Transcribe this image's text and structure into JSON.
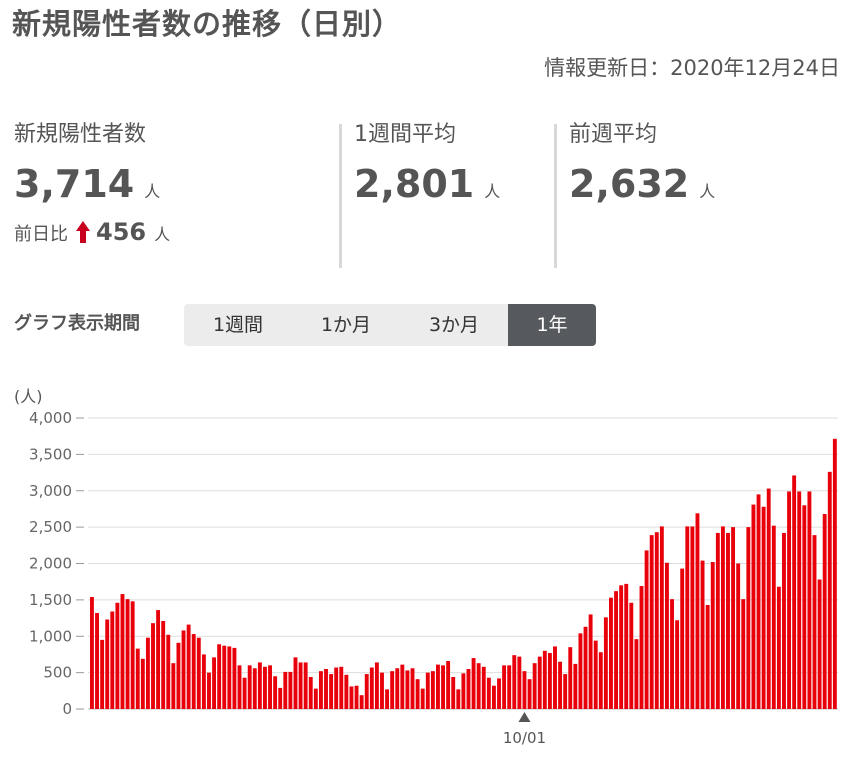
{
  "header": {
    "title": "新規陽性者数の推移（日別）",
    "updated": "情報更新日：2020年12月24日"
  },
  "stats": [
    {
      "label": "新規陽性者数",
      "value": "3,714",
      "unit": "人"
    },
    {
      "label": "1週間平均",
      "value": "2,801",
      "unit": "人"
    },
    {
      "label": "前週平均",
      "value": "2,632",
      "unit": "人"
    }
  ],
  "diff": {
    "label": "前日比",
    "value": "456",
    "unit": "人",
    "direction": "up",
    "arrow_color": "#c8001e"
  },
  "period": {
    "label": "グラフ表示期間",
    "tabs": [
      "1週間",
      "1か月",
      "3か月",
      "1年"
    ],
    "selected": "1年"
  },
  "chart_data": {
    "type": "bar",
    "ylabel": "(人)",
    "ylim": [
      0,
      4000
    ],
    "yticks": [
      "0",
      "500",
      "1,000",
      "1,500",
      "2,000",
      "2,500",
      "3,000",
      "3,500",
      "4,000"
    ],
    "xticks": [
      {
        "label": "10/01",
        "index": 85
      }
    ],
    "bar_color": "#e8000b",
    "grid": true,
    "series": [
      {
        "values": [
          1540,
          1320,
          950,
          1230,
          1340,
          1460,
          1580,
          1510,
          1480,
          830,
          690,
          980,
          1180,
          1360,
          1210,
          1020,
          630,
          910,
          1080,
          1160,
          1030,
          980,
          750,
          500,
          710,
          890,
          870,
          860,
          840,
          600,
          430,
          600,
          560,
          640,
          580,
          600,
          450,
          290,
          510,
          510,
          710,
          640,
          640,
          440,
          280,
          520,
          550,
          480,
          570,
          580,
          470,
          310,
          320,
          190,
          480,
          570,
          640,
          500,
          270,
          520,
          560,
          610,
          530,
          560,
          410,
          280,
          500,
          520,
          610,
          600,
          660,
          440,
          270,
          490,
          550,
          700,
          630,
          580,
          430,
          320,
          420,
          600,
          600,
          740,
          720,
          520,
          410,
          630,
          720,
          800,
          770,
          860,
          650,
          480,
          850,
          620,
          1040,
          1130,
          1300,
          940,
          780,
          1260,
          1530,
          1620,
          1700,
          1720,
          1460,
          960,
          1690,
          2180,
          2390,
          2430,
          2510,
          2010,
          1510,
          1220,
          1930,
          2510,
          2510,
          2690,
          2040,
          1430,
          2020,
          2420,
          2510,
          2420,
          2500,
          2000,
          1510,
          2500,
          2810,
          2950,
          2780,
          3030,
          2520,
          1680,
          2420,
          2990,
          3210,
          2990,
          2800,
          2990,
          2390,
          1780,
          2680,
          3260,
          3714
        ]
      }
    ]
  }
}
